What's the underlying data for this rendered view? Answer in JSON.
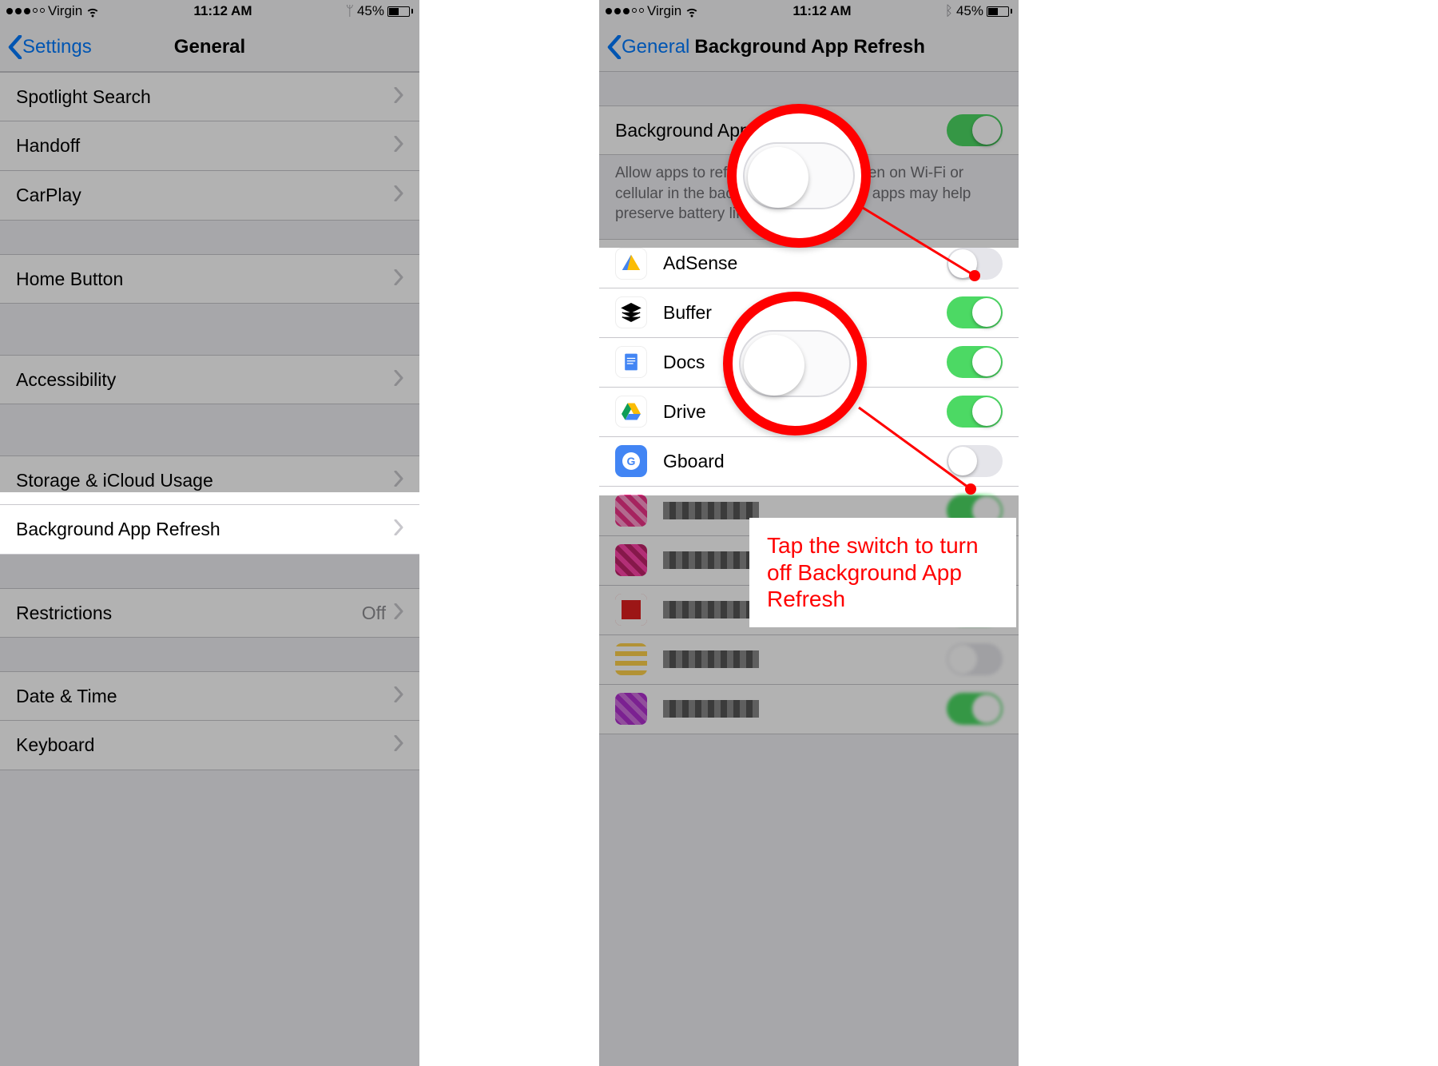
{
  "status": {
    "carrier": "Virgin",
    "time": "11:12 AM",
    "battery_pct": "45%"
  },
  "left": {
    "back_label": "Settings",
    "title": "General",
    "rows": {
      "spotlight": "Spotlight Search",
      "handoff": "Handoff",
      "carplay": "CarPlay",
      "home_button": "Home Button",
      "accessibility": "Accessibility",
      "storage": "Storage & iCloud Usage",
      "bg_refresh": "Background App Refresh",
      "restrictions": "Restrictions",
      "restrictions_value": "Off",
      "date_time": "Date & Time",
      "keyboard": "Keyboard"
    }
  },
  "right": {
    "back_label": "General",
    "title": "Background App Refresh",
    "master_label": "Background App Refresh",
    "desc": "Allow apps to refresh their content when on Wi-Fi or cellular in the background. Turning off apps may help preserve battery life.",
    "apps": {
      "adsense": "AdSense",
      "buffer": "Buffer",
      "docs": "Docs",
      "drive": "Drive",
      "gboard": "Gboard"
    }
  },
  "annotation": "Tap the switch to turn off Background App Refresh"
}
